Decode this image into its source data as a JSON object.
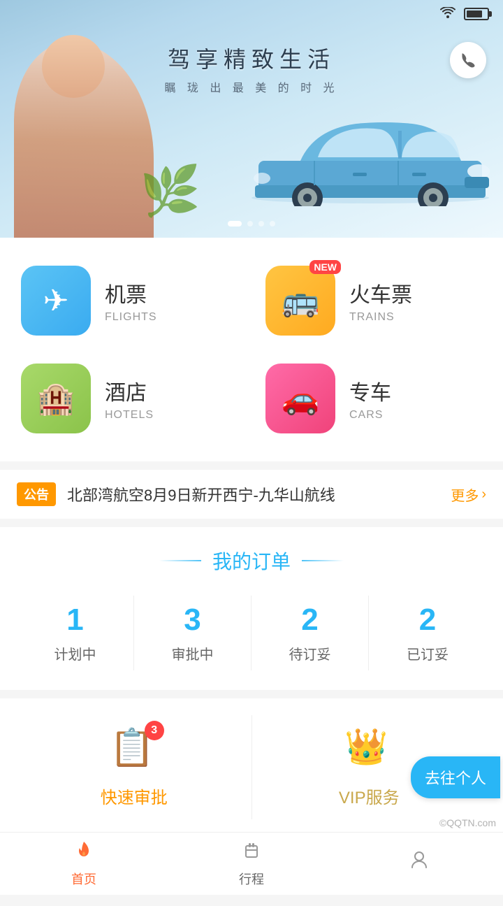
{
  "statusBar": {
    "wifiIcon": "WiFi",
    "batteryIcon": "Battery"
  },
  "heroBanner": {
    "title": "驾享精致生活",
    "subtitle": "瞩 珑 出 最 美 的 时 光",
    "phoneIcon": "📞",
    "dots": [
      true,
      false,
      false,
      false
    ]
  },
  "services": [
    {
      "id": "flights",
      "nameCn": "机票",
      "nameEn": "FLIGHTS",
      "icon": "✈",
      "colorClass": "flights-icon",
      "newBadge": false
    },
    {
      "id": "trains",
      "nameCn": "火车票",
      "nameEn": "TRAINS",
      "icon": "🚌",
      "colorClass": "trains-icon",
      "newBadge": true,
      "badgeText": "NEW"
    },
    {
      "id": "hotels",
      "nameCn": "酒店",
      "nameEn": "HOTELS",
      "icon": "🏨",
      "colorClass": "hotels-icon",
      "newBadge": false
    },
    {
      "id": "cars",
      "nameCn": "专车",
      "nameEn": "CARS",
      "icon": "🚗",
      "colorClass": "cars-icon",
      "newBadge": false
    }
  ],
  "announcement": {
    "tag": "公告",
    "text": "北部湾航空8月9日新开西宁-九华山航线",
    "moreText": "更多",
    "moreIcon": "›"
  },
  "orders": {
    "sectionTitle": "我的订单",
    "dividerLeft": "—",
    "dividerRight": "—",
    "items": [
      {
        "count": "1",
        "label": "计划中"
      },
      {
        "count": "3",
        "label": "审批中"
      },
      {
        "count": "2",
        "label": "待订妥"
      },
      {
        "count": "2",
        "label": "已订妥"
      }
    ]
  },
  "quickActions": {
    "approval": {
      "icon": "📋",
      "label": "快速审批",
      "badge": "3"
    },
    "vip": {
      "icon": "👑",
      "label": "VIP服务"
    },
    "goPersonalBtn": "去往个人"
  },
  "bottomNav": {
    "items": [
      {
        "id": "home",
        "icon": "🔥",
        "label": "首页",
        "active": true
      },
      {
        "id": "trips",
        "icon": "🧳",
        "label": "行程",
        "active": false
      },
      {
        "id": "profile",
        "icon": "👤",
        "label": "",
        "active": false
      }
    ]
  },
  "watermark": "©QQTN.com"
}
